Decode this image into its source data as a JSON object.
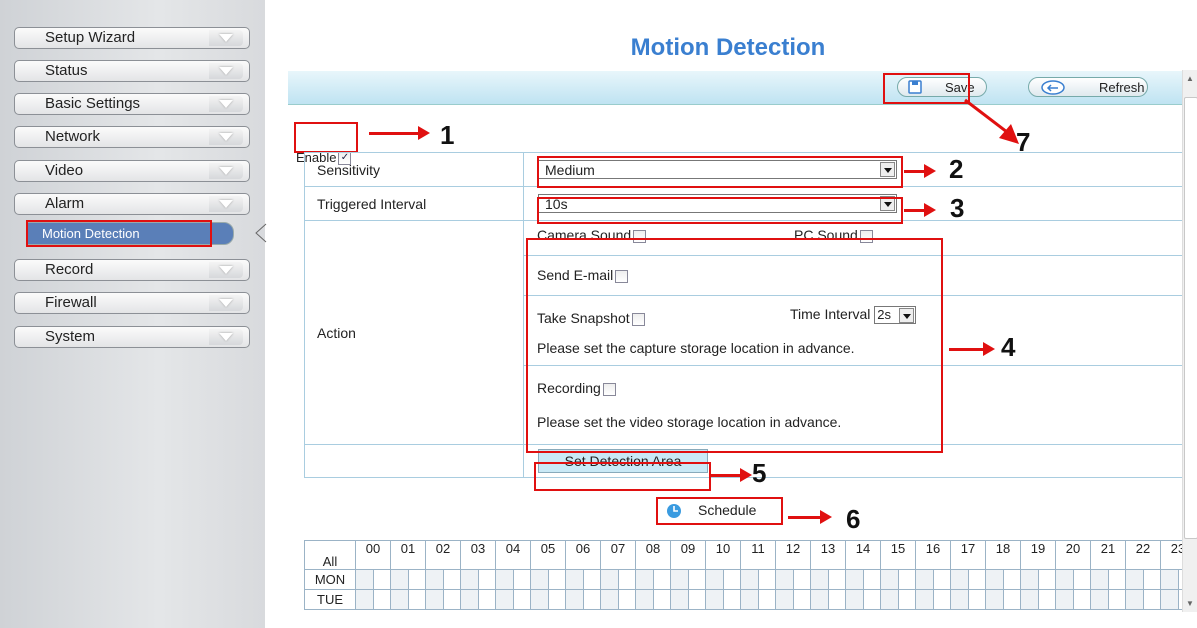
{
  "sidebar": {
    "items": [
      {
        "label": "Setup Wizard"
      },
      {
        "label": "Status"
      },
      {
        "label": "Basic Settings"
      },
      {
        "label": "Network"
      },
      {
        "label": "Video"
      },
      {
        "label": "Alarm"
      },
      {
        "label": "Record"
      },
      {
        "label": "Firewall"
      },
      {
        "label": "System"
      }
    ],
    "active_sub": "Motion Detection"
  },
  "page": {
    "title": "Motion Detection"
  },
  "toolbar": {
    "save_label": "Save",
    "refresh_label": "Refresh"
  },
  "form": {
    "enable_label": "Enable",
    "enable_checked": true,
    "sensitivity_label": "Sensitivity",
    "sensitivity_value": "Medium",
    "interval_label": "Triggered Interval",
    "interval_value": "10s",
    "action_label": "Action",
    "camera_sound": "Camera Sound",
    "pc_sound": "PC Sound",
    "send_email": "Send E-mail",
    "take_snapshot": "Take Snapshot",
    "time_interval_label": "Time Interval",
    "time_interval_value": "2s",
    "snapshot_note": "Please set the capture storage location in advance.",
    "recording": "Recording",
    "recording_note": "Please set the video storage location in advance.",
    "detection_area_label": "Set Detection Area",
    "schedule_label": "Schedule"
  },
  "annotations": {
    "n1": "1",
    "n2": "2",
    "n3": "3",
    "n4": "4",
    "n5": "5",
    "n6": "6",
    "n7": "7"
  },
  "schedule": {
    "all_label": "All",
    "hours": [
      "00",
      "01",
      "02",
      "03",
      "04",
      "05",
      "06",
      "07",
      "08",
      "09",
      "10",
      "11",
      "12",
      "13",
      "14",
      "15",
      "16",
      "17",
      "18",
      "19",
      "20",
      "21",
      "22",
      "23"
    ],
    "days": [
      "MON",
      "TUE"
    ]
  },
  "colors": {
    "accent": "#3a7fd0",
    "highlight": "#e01010"
  }
}
